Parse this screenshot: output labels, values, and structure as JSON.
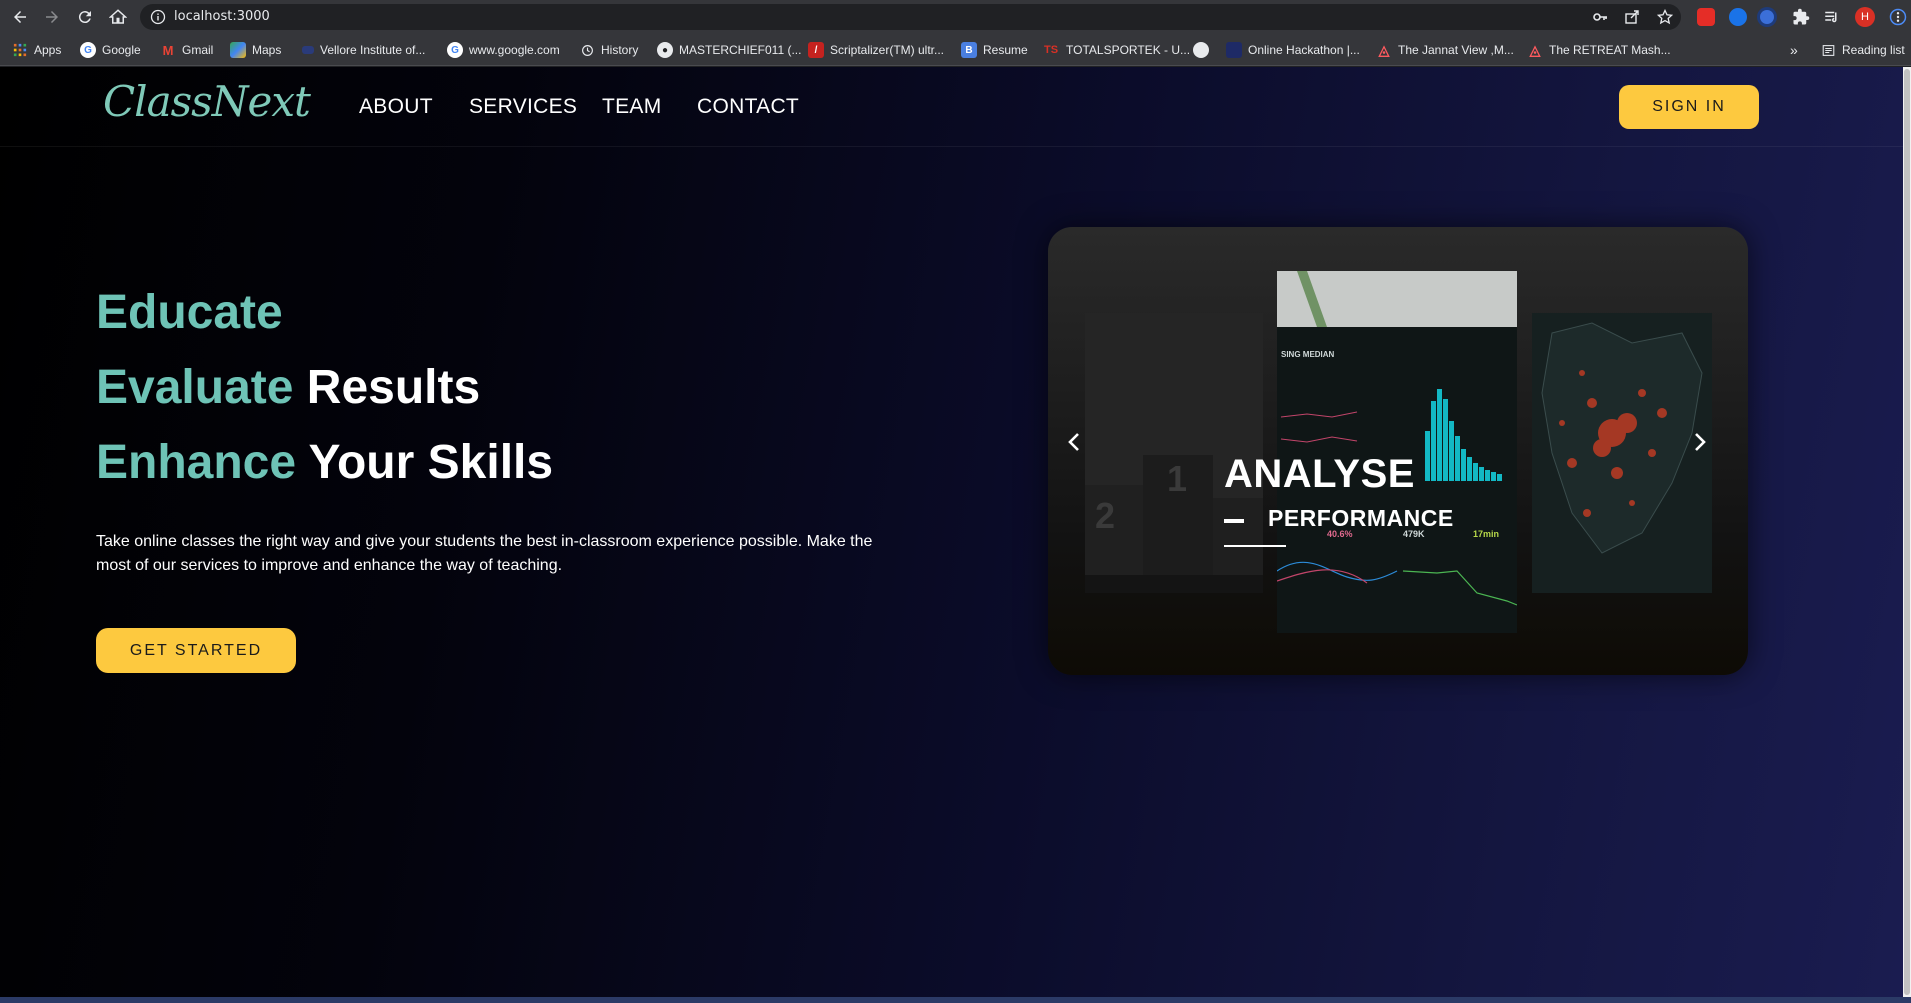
{
  "browser": {
    "url": "localhost:3000",
    "bookmarks": [
      {
        "label": "Apps",
        "icon": "apps-grid-icon"
      },
      {
        "label": "Google",
        "icon": "google-icon"
      },
      {
        "label": "Gmail",
        "icon": "gmail-icon"
      },
      {
        "label": "Maps",
        "icon": "maps-icon"
      },
      {
        "label": "Vellore Institute of...",
        "icon": "vit-icon"
      },
      {
        "label": "www.google.com",
        "icon": "google-icon"
      },
      {
        "label": "History",
        "icon": "history-icon"
      },
      {
        "label": "MASTERCHIEF011 (...",
        "icon": "github-icon"
      },
      {
        "label": "Scriptalizer(TM) ultr...",
        "icon": "scriptalizer-icon"
      },
      {
        "label": "Resume",
        "icon": "resume-b-icon"
      },
      {
        "label": "TOTALSPORTEK - U...",
        "icon": "ts-icon"
      },
      {
        "label": "",
        "icon": "globe-icon"
      },
      {
        "label": "Online Hackathon |...",
        "icon": "hackathon-icon"
      },
      {
        "label": "The Jannat View ,M...",
        "icon": "airbnb-icon"
      },
      {
        "label": "The RETREAT Mash...",
        "icon": "airbnb-icon"
      }
    ],
    "more_bookmarks": "»",
    "reading_list": "Reading list",
    "profile_initial": "H"
  },
  "site": {
    "logo": "ClassNext",
    "nav": [
      "ABOUT",
      "SERVICES",
      "TEAM",
      "CONTACT"
    ],
    "sign_in": "SIGN IN"
  },
  "hero": {
    "line1_accent": "Educate",
    "line2_accent": "Evaluate",
    "line2_rest": "Results",
    "line3_accent": "Enhance",
    "line3_rest": "Your Skills",
    "description": "Take online classes the right way and give your students the best in-classroom experience possible. Make the most of our services to improve and enhance the way of teaching.",
    "cta": "GET STARTED"
  },
  "carousel": {
    "caption_title": "ANALYSE",
    "caption_subtitle": "PERFORMANCE",
    "prev_icon": "chevron-left-icon",
    "next_icon": "chevron-right-icon",
    "center_slide": {
      "header": "SING MEDIAN",
      "stat_1": "40.6%",
      "stat_2": "479K",
      "stat_3": "17min"
    }
  },
  "colors": {
    "accent_teal": "#6ec3b6",
    "button_yellow": "#fdc93f",
    "bg_dark": "#000000",
    "bg_navy": "#1a1c50"
  }
}
